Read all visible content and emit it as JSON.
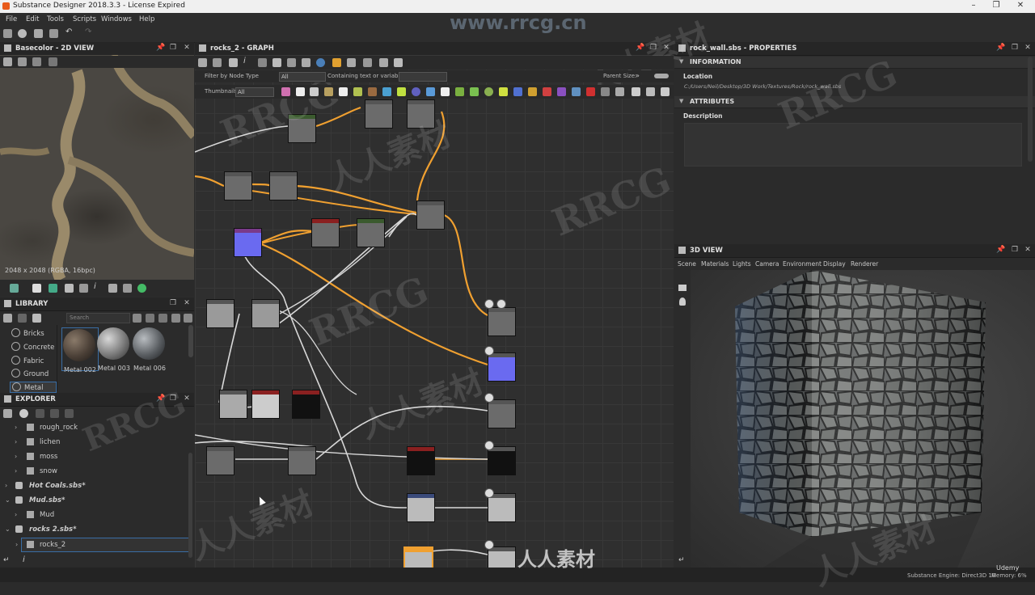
{
  "window": {
    "title": "Substance Designer 2018.3.3 - License Expired"
  },
  "menu": [
    "File",
    "Edit",
    "Tools",
    "Scripts",
    "Windows",
    "Help"
  ],
  "view2d": {
    "title": "Basecolor - 2D VIEW",
    "info": "2048 x 2048 (RGBA, 16bpc)"
  },
  "graph": {
    "title": "rocks_2 - GRAPH",
    "filter_label": "Filter by Node Type",
    "filter_value": "All",
    "containing_label": "Containing text or variable",
    "thumbnails_label": "Thumbnails:",
    "thumbnails_value": "All",
    "parent_size_label": "Parent Size:"
  },
  "library": {
    "title": "LIBRARY",
    "search_placeholder": "Search",
    "categories": [
      "Bricks",
      "Concrete",
      "Fabric",
      "Ground",
      "Metal"
    ],
    "thumbs": [
      "Metal 002",
      "Metal 003",
      "Metal 006"
    ]
  },
  "explorer": {
    "title": "EXPLORER",
    "items": [
      "rough_rock",
      "lichen",
      "moss",
      "snow",
      "Hot Coals.sbs*",
      "Mud.sbs*",
      "Mud",
      "rocks 2.sbs*",
      "rocks_2"
    ]
  },
  "properties": {
    "title": "rock_wall.sbs - PROPERTIES",
    "information": "INFORMATION",
    "location_label": "Location",
    "location_value": "C:/Users/Neil/Desktop/3D Work/Textures/Rock/rock_wall.sbs",
    "attributes": "ATTRIBUTES",
    "description_label": "Description"
  },
  "view3d": {
    "title": "3D VIEW",
    "menu": [
      "Scene",
      "Materials",
      "Lights",
      "Camera",
      "Environment",
      "Display",
      "Renderer"
    ]
  },
  "status": {
    "engine": "Substance Engine: Direct3D 10",
    "memory": "Memory: 6%"
  },
  "watermark": {
    "site": "www.rrcg.cn",
    "brand": "RRCG",
    "cn": "人人素材",
    "udemy": "Udemy"
  },
  "colors": {
    "accent_orange": "#f0a030",
    "selection_blue": "#3a6ea5",
    "link_white": "#d8d8d8"
  }
}
